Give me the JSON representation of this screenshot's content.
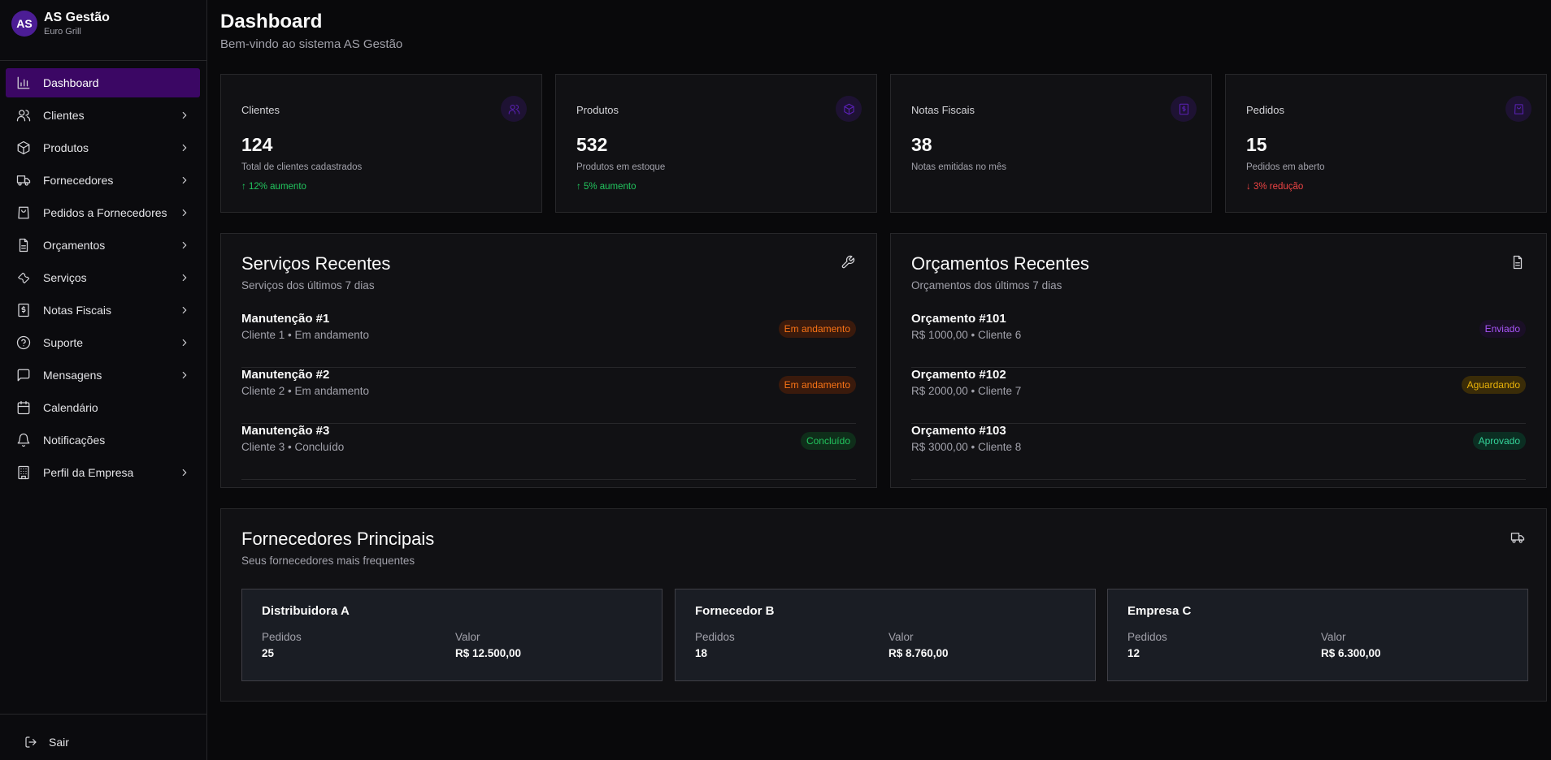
{
  "brand": {
    "initials": "AS",
    "title": "AS Gestão",
    "subtitle": "Euro Grill"
  },
  "nav": [
    {
      "label": "Dashboard",
      "icon": "bar-chart-icon",
      "active": true,
      "chevron": false
    },
    {
      "label": "Clientes",
      "icon": "users-icon",
      "chevron": true
    },
    {
      "label": "Produtos",
      "icon": "box-icon",
      "chevron": true
    },
    {
      "label": "Fornecedores",
      "icon": "truck-icon",
      "chevron": true
    },
    {
      "label": "Pedidos a Fornecedores",
      "icon": "shopping-bag-icon",
      "chevron": true
    },
    {
      "label": "Orçamentos",
      "icon": "file-text-icon",
      "chevron": true
    },
    {
      "label": "Serviços",
      "icon": "wrench-icon",
      "chevron": true
    },
    {
      "label": "Notas Fiscais",
      "icon": "receipt-dollar-icon",
      "chevron": true
    },
    {
      "label": "Suporte",
      "icon": "help-circle-icon",
      "chevron": true
    },
    {
      "label": "Mensagens",
      "icon": "message-square-icon",
      "chevron": true
    },
    {
      "label": "Calendário",
      "icon": "calendar-icon",
      "chevron": false
    },
    {
      "label": "Notificações",
      "icon": "bell-icon",
      "chevron": false
    },
    {
      "label": "Perfil da Empresa",
      "icon": "building-icon",
      "chevron": true
    }
  ],
  "logout_label": "Sair",
  "header": {
    "title": "Dashboard",
    "subtitle": "Bem-vindo ao sistema AS Gestão"
  },
  "stats": [
    {
      "label": "Clientes",
      "value": "124",
      "desc": "Total de clientes cadastrados",
      "trend": "↑ 12% aumento",
      "trend_dir": "up",
      "icon": "users-icon"
    },
    {
      "label": "Produtos",
      "value": "532",
      "desc": "Produtos em estoque",
      "trend": "↑ 5% aumento",
      "trend_dir": "up",
      "icon": "box-icon"
    },
    {
      "label": "Notas Fiscais",
      "value": "38",
      "desc": "Notas emitidas no mês",
      "trend": "",
      "trend_dir": "",
      "icon": "receipt-dollar-icon"
    },
    {
      "label": "Pedidos",
      "value": "15",
      "desc": "Pedidos em aberto",
      "trend": "↓ 3% redução",
      "trend_dir": "down",
      "icon": "shopping-bag-icon"
    }
  ],
  "services": {
    "title": "Serviços Recentes",
    "subtitle": "Serviços dos últimos 7 dias",
    "icon": "wrench-icon",
    "items": [
      {
        "title": "Manutenção #1",
        "sub": "Cliente 1 • Em andamento",
        "badge": "Em andamento",
        "badge_color": "#f97316"
      },
      {
        "title": "Manutenção #2",
        "sub": "Cliente 2 • Em andamento",
        "badge": "Em andamento",
        "badge_color": "#f97316"
      },
      {
        "title": "Manutenção #3",
        "sub": "Cliente 3 • Concluído",
        "badge": "Concluído",
        "badge_color": "#22c55e"
      }
    ]
  },
  "quotes": {
    "title": "Orçamentos Recentes",
    "subtitle": "Orçamentos dos últimos 7 dias",
    "icon": "file-text-icon",
    "items": [
      {
        "title": "Orçamento #101",
        "sub": "R$ 1000,00 • Cliente 6",
        "badge": "Enviado",
        "badge_color": "#a855f7"
      },
      {
        "title": "Orçamento #102",
        "sub": "R$ 2000,00 • Cliente 7",
        "badge": "Aguardando",
        "badge_color": "#eab308"
      },
      {
        "title": "Orçamento #103",
        "sub": "R$ 3000,00 • Cliente 8",
        "badge": "Aprovado",
        "badge_color": "#34d399"
      }
    ]
  },
  "suppliers": {
    "title": "Fornecedores Principais",
    "subtitle": "Seus fornecedores mais frequentes",
    "icon": "truck-icon",
    "orders_label": "Pedidos",
    "value_label": "Valor",
    "items": [
      {
        "name": "Distribuidora A",
        "orders": "25",
        "value": "R$ 12.500,00"
      },
      {
        "name": "Fornecedor B",
        "orders": "18",
        "value": "R$ 8.760,00"
      },
      {
        "name": "Empresa C",
        "orders": "12",
        "value": "R$ 6.300,00"
      }
    ]
  },
  "colors": {
    "accent": "#3b0764",
    "background": "#09090b",
    "card": "#111114",
    "up": "#22c55e",
    "down": "#ef4444"
  }
}
